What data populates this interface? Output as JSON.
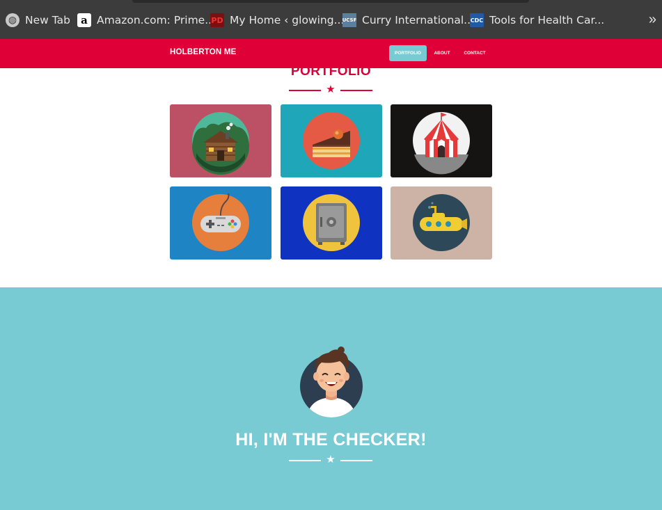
{
  "bookmarks": {
    "items": [
      {
        "label": "New Tab",
        "icon": "globe-icon"
      },
      {
        "label": "Amazon.com: Prime...",
        "icon": "amazon-icon"
      },
      {
        "label": "My Home ‹ glowing...",
        "icon": "myhome-icon"
      },
      {
        "label": "Curry International...",
        "icon": "ucsf-icon"
      },
      {
        "label": "Tools for Health Car...",
        "icon": "cdc-icon"
      }
    ],
    "more_label": "»"
  },
  "navbar": {
    "brand": "HOLBERTON ME",
    "items": [
      "PORTFOLIO",
      "ABOUT",
      "CONTACT"
    ],
    "active_item": "PORTFOLIO",
    "background_color": "#e00038",
    "active_color": "#78cbd2"
  },
  "portfolio": {
    "title": "PORTFOLIO",
    "star": "★",
    "tiles": [
      {
        "icon": "cabin-icon",
        "background": "#bc5064"
      },
      {
        "icon": "cake-icon",
        "background": "#1fa7b9"
      },
      {
        "icon": "circus-tent-icon",
        "background": "#161313"
      },
      {
        "icon": "game-controller-icon",
        "background": "#1f84c4"
      },
      {
        "icon": "safe-icon",
        "background": "#0f33c0"
      },
      {
        "icon": "submarine-icon",
        "background": "#cdb3a5"
      }
    ]
  },
  "checker": {
    "title": "HI, I'M THE CHECKER!",
    "star": "★",
    "avatar_icon": "avatar-icon",
    "background_color": "#78cbd2"
  }
}
